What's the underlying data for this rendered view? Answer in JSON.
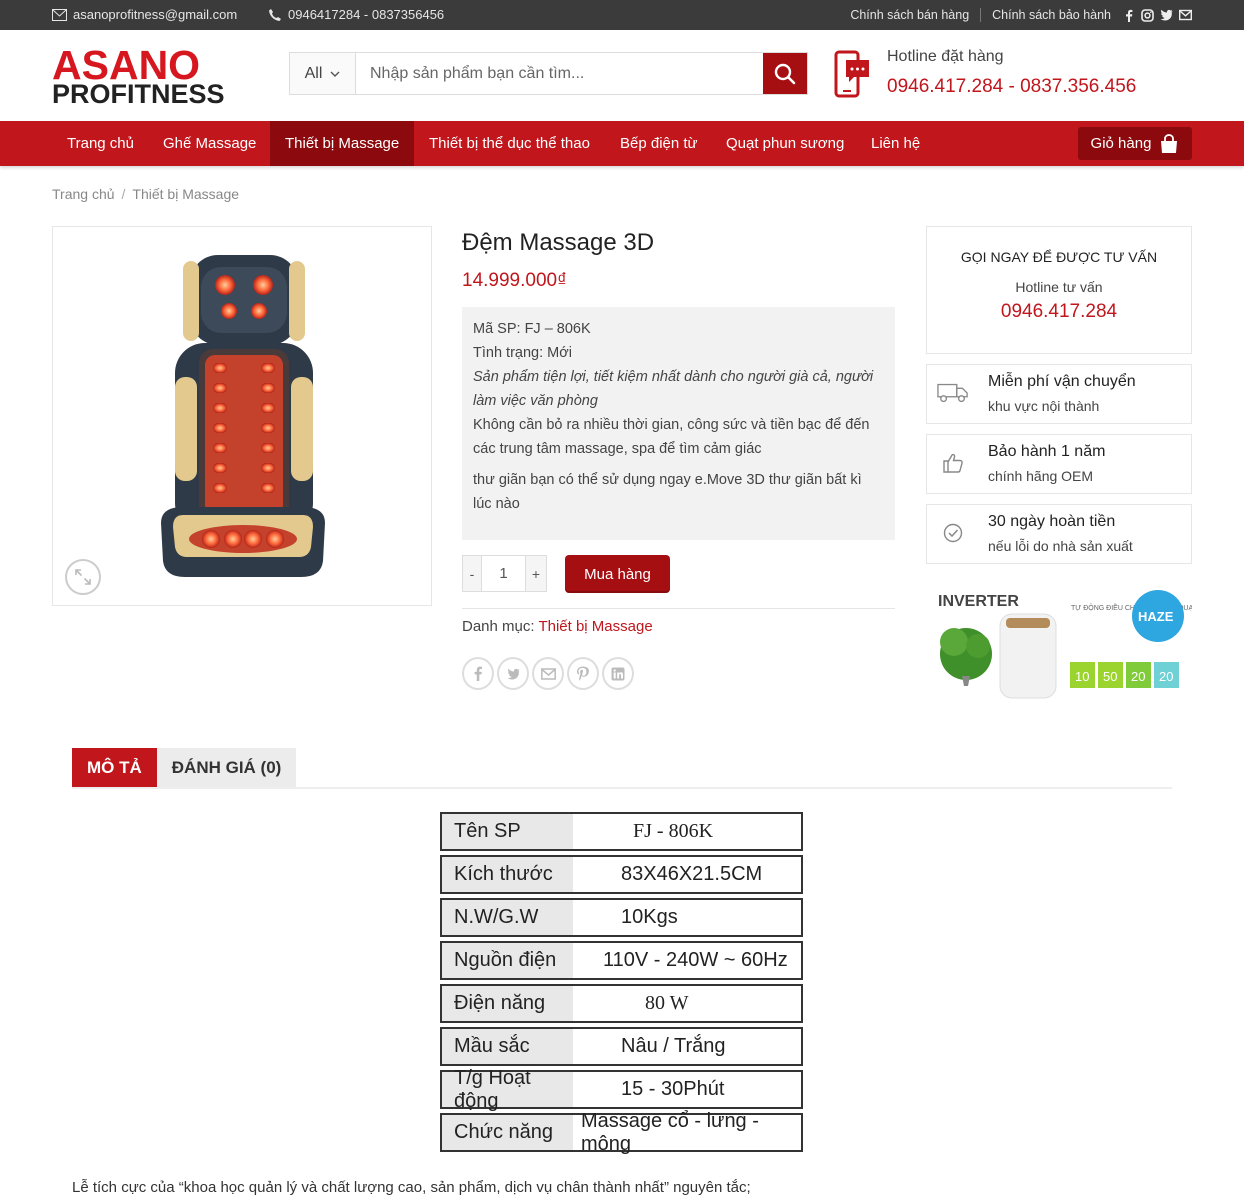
{
  "topbar": {
    "email": "asanoprofitness@gmail.com",
    "phone": "0946417284 - 0837356456",
    "links": [
      "Chính sách bán hàng",
      "Chính sách bảo hành"
    ],
    "social_icons": [
      "facebook-icon",
      "instagram-icon",
      "twitter-icon",
      "envelope-icon"
    ]
  },
  "header": {
    "logo_line1": "ASANO",
    "logo_line2": "PROFITNESS",
    "search_category": "All",
    "search_placeholder": "Nhập sản phẩm bạn cần tìm...",
    "hotline_label": "Hotline đặt hàng",
    "hotline_numbers": "0946.417.284 - 0837.356.456"
  },
  "nav": {
    "items": [
      "Trang chủ",
      "Ghế Massage",
      "Thiết bị Massage",
      "Thiết bị thể dục thể thao",
      "Bếp điện từ",
      "Quạt phun sương",
      "Liên hệ"
    ],
    "active": "Thiết bị Massage",
    "cart_label": "Giỏ hàng"
  },
  "breadcrumb": [
    "Trang chủ",
    "Thiết bị Massage"
  ],
  "product": {
    "title": "Đệm Massage 3D",
    "price": "14.999.000₫",
    "code": "Mã SP: FJ – 806K",
    "condition": "Tình trạng: Mới",
    "tagline": "Sản phẩm tiện lợi, tiết kiệm nhất dành cho người già cả, người làm việc văn phòng",
    "desc1": "Không cần bỏ ra nhiều thời gian, công sức và tiền bạc để đến  các trung tâm massage, spa để tìm cảm giác",
    "desc2": "thư giãn bạn có thể sử dụng ngay e.Move 3D thư giãn bất kì lúc nào",
    "qty_minus": "-",
    "qty_value": "1",
    "qty_plus": "+",
    "buy_label": "Mua hàng",
    "category_label": "Danh mục: ",
    "category": "Thiết bị Massage",
    "share_icons": [
      "facebook-icon",
      "twitter-icon",
      "email-icon",
      "pinterest-icon",
      "linkedin-icon"
    ]
  },
  "sidebar": {
    "consult_title": "GỌI NGAY ĐỂ ĐƯỢC TƯ VẤN",
    "consult_label": "Hotline tư vấn",
    "consult_phone": "0946.417.284",
    "features": [
      {
        "icon": "truck-icon",
        "title": "Miễn phí vận chuyển",
        "sub": "khu vực nội thành"
      },
      {
        "icon": "thumbs-up-icon",
        "title": "Bảo hành 1 năm",
        "sub": "chính hãng OEM"
      },
      {
        "icon": "check-circle-icon",
        "title": "30 ngày hoàn tiền",
        "sub": "nếu lỗi do nhà sản xuất"
      }
    ],
    "banner": {
      "inverter": "INVERTER",
      "haze": "HAZE",
      "auto_text": "TỰ ĐỘNG ĐIỀU CHỈNH TỐC ĐỘ QUẠT",
      "levels": [
        "10",
        "50",
        "20",
        "20"
      ]
    }
  },
  "tabs": {
    "description": "MÔ TẢ",
    "reviews": "ĐÁNH GIÁ (0)"
  },
  "specs": [
    {
      "k": "Tên SP",
      "v": "FJ - 806K"
    },
    {
      "k": "Kích thước",
      "v": "83X46X21.5CM"
    },
    {
      "k": "N.W/G.W",
      "v": "10Kgs"
    },
    {
      "k": "Nguồn điện",
      "v": "110V - 240W ~ 60Hz"
    },
    {
      "k": "Điện năng",
      "v": "80 W"
    },
    {
      "k": "Mầu sắc",
      "v": "Nâu / Trắng"
    },
    {
      "k": "T/g Hoạt động",
      "v": "15 - 30Phút"
    },
    {
      "k": "Chức năng",
      "v": "Massage cổ - lưng - mông"
    }
  ],
  "footer_text": "Lễ tích cực của “khoa học quản lý và chất lượng cao, sản phẩm, dịch vụ chân thành nhất” nguyên tắc;"
}
